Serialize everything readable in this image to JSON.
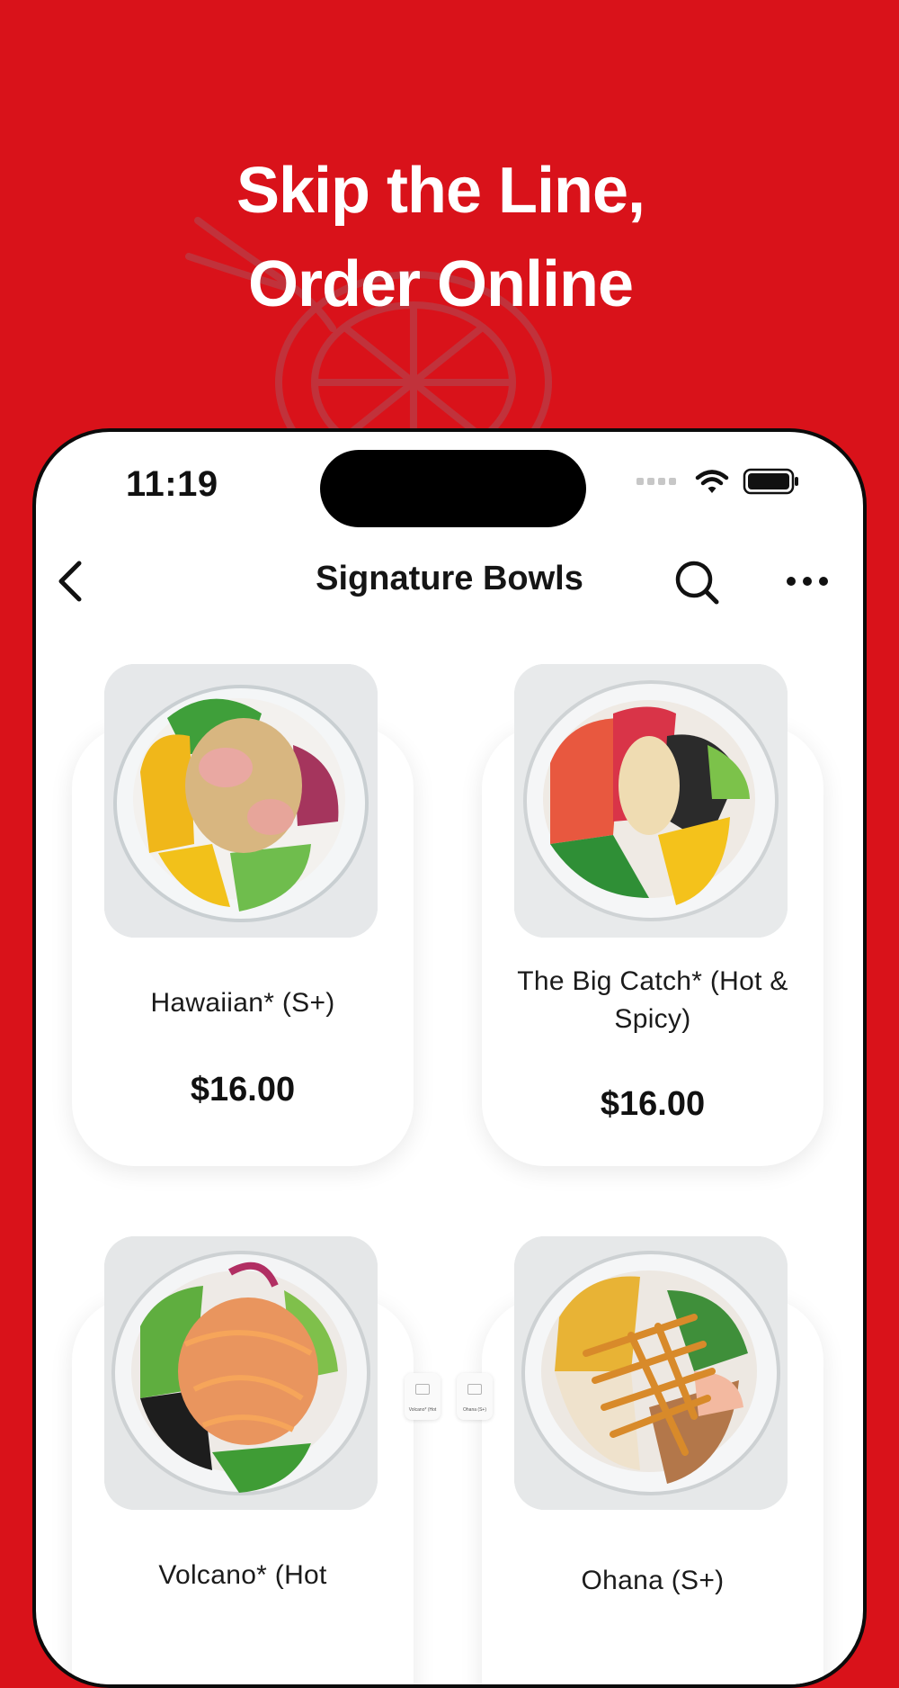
{
  "promo": {
    "headline_line1": "Skip the Line,",
    "headline_line2": "Order Online"
  },
  "status_bar": {
    "time": "11:19"
  },
  "nav": {
    "title": "Signature Bowls",
    "back_icon": "chevron-left-icon",
    "search_icon": "search-icon",
    "more_icon": "ellipsis-icon"
  },
  "menu_items": [
    {
      "name": "Hawaiian* (S+)",
      "price": "$16.00"
    },
    {
      "name": "The Big Catch* (Hot & Spicy)",
      "price": "$16.00"
    },
    {
      "name": "Volcano* (Hot",
      "price": ""
    },
    {
      "name": "Ohana (S+)",
      "price": ""
    }
  ],
  "mini_thumbs": [
    {
      "label": "Volcano* (Hot"
    },
    {
      "label": "Ohana (S+)"
    }
  ],
  "colors": {
    "brand_red": "#d9121a",
    "card_bg": "#ffffff",
    "text_dark": "#111111"
  }
}
